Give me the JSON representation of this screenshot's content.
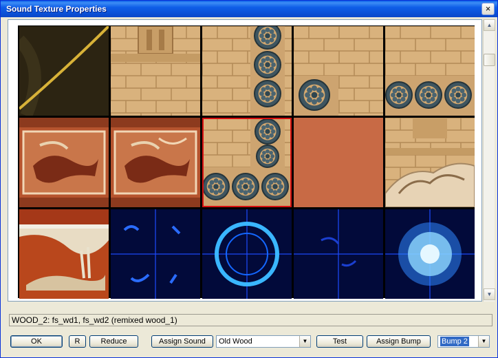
{
  "window": {
    "title": "Sound Texture Properties",
    "close_label": "×"
  },
  "status_text": "WOOD_2:  fs_wd1, fs_wd2 (remixed wood_1)",
  "buttons": {
    "ok": "OK",
    "r": "R",
    "reduce": "Reduce",
    "assign_sound": "Assign Sound",
    "test": "Test",
    "assign_bump": "Assign Bump"
  },
  "sound_select": {
    "value": "Old Wood"
  },
  "bump_select": {
    "value": "Bump 2"
  },
  "scrollbar": {
    "up": "▲",
    "down": "▼"
  },
  "tiles": [
    {
      "name": "tile-dark-marble-gold-line",
      "kind": "marble"
    },
    {
      "name": "tile-sandstone-window",
      "kind": "stone"
    },
    {
      "name": "tile-rosette-column",
      "kind": "rosette-col"
    },
    {
      "name": "tile-sandstone-corner",
      "kind": "stone-corner"
    },
    {
      "name": "tile-rosette-frieze",
      "kind": "rosette-row"
    },
    {
      "name": "tile-fresco-bull-1",
      "kind": "fresco"
    },
    {
      "name": "tile-fresco-bull-2",
      "kind": "fresco2"
    },
    {
      "name": "tile-rosette-junction",
      "kind": "rosette-t"
    },
    {
      "name": "tile-terracotta-solid",
      "kind": "solid"
    },
    {
      "name": "tile-carved-relief",
      "kind": "relief"
    },
    {
      "name": "tile-fresco-animal",
      "kind": "fresco3"
    },
    {
      "name": "tile-blue-glyphs",
      "kind": "blue1"
    },
    {
      "name": "tile-blue-ring",
      "kind": "blue2"
    },
    {
      "name": "tile-blue-dark",
      "kind": "blue3"
    },
    {
      "name": "tile-blue-orb",
      "kind": "blue4"
    }
  ],
  "selected_tile": 7,
  "colors": {
    "selection": "#d81010",
    "title_bar": "#0a5fe8",
    "terracotta": "#c86a45"
  }
}
